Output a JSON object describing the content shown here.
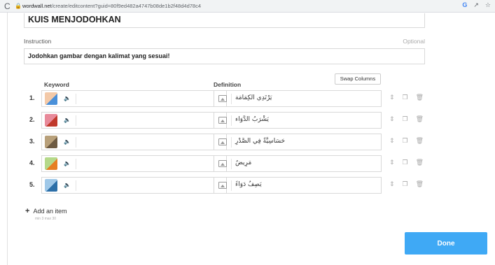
{
  "browser": {
    "url_host": "wordwall.net",
    "url_path": "/create/editcontent?guid=80f9ed482a4747b08de1b2f48d4d78c4",
    "reload_glyph": "C"
  },
  "activity_title": "KUIS MENJODOHKAN",
  "instruction": {
    "label": "Instruction",
    "optional_label": "Optional",
    "value": "Jodohkan gambar dengan kalimat yang sesuai!"
  },
  "swap_button_label": "Swap Columns",
  "columns": {
    "keyword": "Keyword",
    "definition": "Definition"
  },
  "rows": [
    {
      "num": "1.",
      "definition": "يَرْتَدِي الكِمَامَة",
      "thumb_color": "#f3c9a8",
      "thumb_accent": "#4a90d9"
    },
    {
      "num": "2.",
      "definition": "يَشْرَبُ الدَّوَاء",
      "thumb_color": "#e88a9a",
      "thumb_accent": "#c0392b"
    },
    {
      "num": "3.",
      "definition": "حَسَاسِيَّةٌ فِي الصَّدْرِ",
      "thumb_color": "#b8a07a",
      "thumb_accent": "#6d5a42"
    },
    {
      "num": "4.",
      "definition": "مَرِيضٌ",
      "thumb_color": "#b5d98a",
      "thumb_accent": "#e67e22"
    },
    {
      "num": "5.",
      "definition": "يَصِفُ دَوَاءً",
      "thumb_color": "#9fc8e8",
      "thumb_accent": "#2c6fa8"
    }
  ],
  "add_item_label": "Add an item",
  "min_max_label": "min 3   max 30",
  "done_label": "Done",
  "colors": {
    "done_button": "#3fa9f5"
  }
}
